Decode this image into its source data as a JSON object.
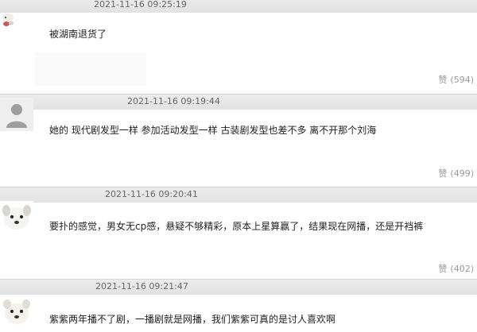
{
  "colors": {
    "meta_bar": "#e6e6e6",
    "body_text": "#222222",
    "muted_text": "#9a9a9a",
    "timestamp_text": "#666666"
  },
  "comments": [
    {
      "timestamp": "2021-11-16 09:25:19",
      "text": "被湖南退货了",
      "like_label": "赞",
      "like_count": "(594)",
      "avatar_icon": "sheep-avatar-icon"
    },
    {
      "timestamp": "2021-11-16 09:19:44",
      "text": "她的 现代剧发型一样 参加活动发型一样 古装剧发型也差不多 离不开那个刘海",
      "like_label": "赞",
      "like_count": "(499)",
      "avatar_icon": "default-user-icon"
    },
    {
      "timestamp": "2021-11-16 09:20:41",
      "text": "要扑的感觉，男女无cp感，悬疑不够精彩，原本上星算赢了，结果现在网播，还是开裆裤",
      "like_label": "赞",
      "like_count": "(402)",
      "avatar_icon": "dog-avatar-icon"
    },
    {
      "timestamp": "2021-11-16 09:21:47",
      "text": "紫紫两年播不了剧，一播剧就是网播，我们紫紫可真的是讨人喜欢啊",
      "like_label": "",
      "like_count": "",
      "avatar_icon": "dog-avatar-icon"
    }
  ]
}
